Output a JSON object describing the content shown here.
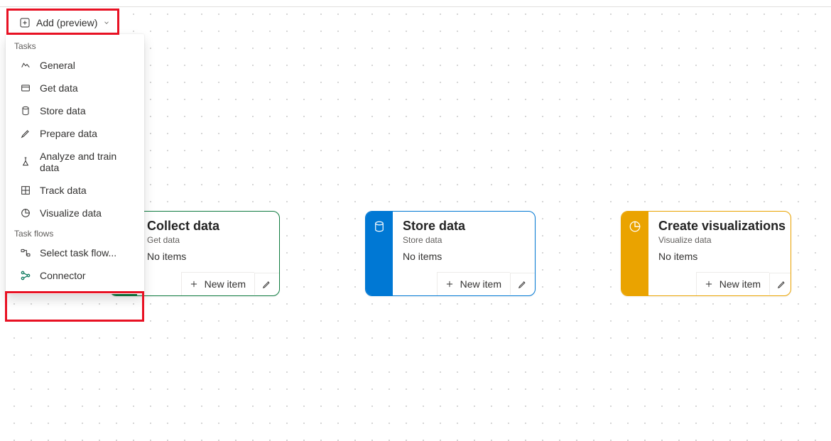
{
  "toolbar": {
    "add_label": "Add (preview)"
  },
  "dropdown": {
    "section_tasks": "Tasks",
    "section_flows": "Task flows",
    "items_tasks": [
      {
        "label": "General"
      },
      {
        "label": "Get data"
      },
      {
        "label": "Store data"
      },
      {
        "label": "Prepare data"
      },
      {
        "label": "Analyze and train data"
      },
      {
        "label": "Track data"
      },
      {
        "label": "Visualize data"
      }
    ],
    "items_flows": [
      {
        "label": "Select task flow..."
      },
      {
        "label": "Connector"
      }
    ]
  },
  "cards": [
    {
      "title": "Collect data",
      "subtitle": "Get data",
      "status": "No items",
      "new_label": "New item"
    },
    {
      "title": "Store data",
      "subtitle": "Store data",
      "status": "No items",
      "new_label": "New item"
    },
    {
      "title": "Create visualizations",
      "subtitle": "Visualize data",
      "status": "No items",
      "new_label": "New item"
    }
  ]
}
